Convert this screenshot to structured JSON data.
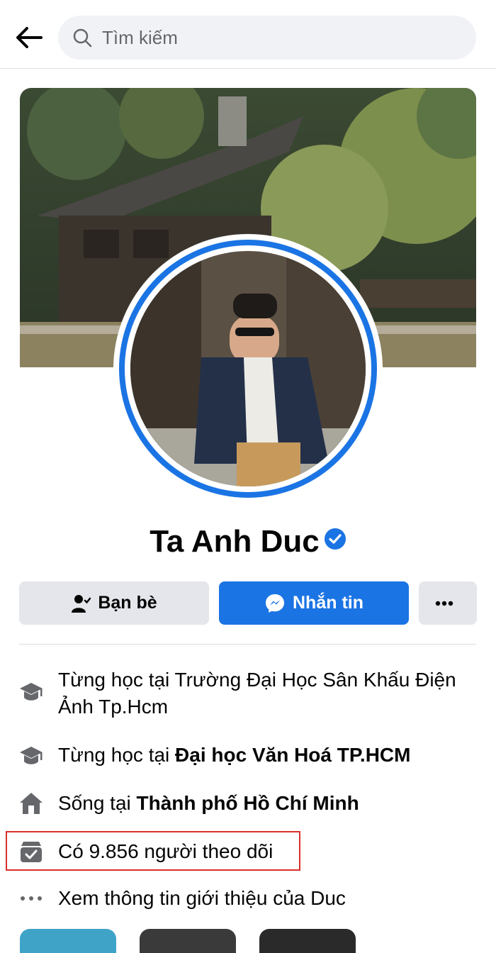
{
  "search": {
    "placeholder": "Tìm kiếm"
  },
  "profile": {
    "name": "Ta Anh Duc"
  },
  "actions": {
    "friends_label": "Bạn bè",
    "message_label": "Nhắn tin",
    "more_label": "•••"
  },
  "intro": {
    "education_1": "Từng học tại Trường Đại Học Sân Khấu Điện Ảnh Tp.Hcm",
    "education_2_prefix": "Từng học tại ",
    "education_2_school": "Đại học Văn Hoá TP.HCM",
    "lives_prefix": "Sống tại ",
    "lives_city": "Thành phố Hồ Chí Minh",
    "followers": "Có 9.856 người theo dõi",
    "see_about": "Xem thông tin giới thiệu của Duc"
  },
  "colors": {
    "accent": "#1b74e4",
    "highlight_box": "#d9302c",
    "button_gray": "#e4e6eb"
  },
  "icons": {
    "back": "arrow-left-icon",
    "search": "search-icon",
    "verified": "verified-badge-icon",
    "friends": "friend-person-icon",
    "messenger": "messenger-icon",
    "more": "more-dots-icon",
    "education": "graduation-cap-icon",
    "home": "home-icon",
    "followers": "followers-icon",
    "about": "ellipsis-icon"
  }
}
